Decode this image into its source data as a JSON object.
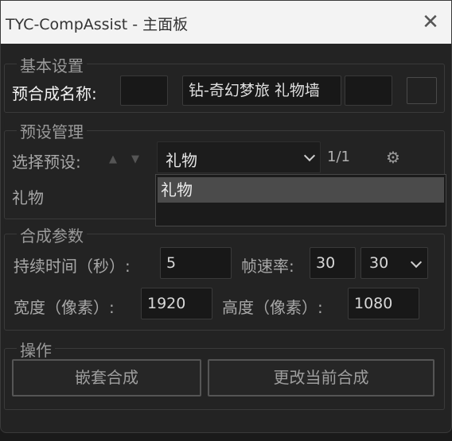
{
  "window": {
    "title": "TYC-CompAssist - 主面板",
    "close_glyph": "✕"
  },
  "basic": {
    "legend": "基本设置",
    "precomp_name_label": "预合成名称:",
    "field1_value": "",
    "field2_value": "钻-奇幻梦旅 礼物墙",
    "field3_value": ""
  },
  "presets": {
    "legend": "预设管理",
    "select_label": "选择预设:",
    "up_arrow": "▲",
    "down_arrow": "▼",
    "selected": "礼物",
    "counter": "1/1",
    "gear_glyph": "⚙",
    "name_label": "礼物",
    "dropdown_options": [
      "礼物"
    ]
  },
  "comp": {
    "legend": "合成参数",
    "duration_label": "持续时间（秒）:",
    "duration_value": "5",
    "fps_label": "帧速率:",
    "fps_value": "30",
    "fps_select": "30",
    "width_label": "宽度（像素）:",
    "width_value": "1920",
    "height_label": "高度（像素）:",
    "height_value": "1080"
  },
  "ops": {
    "legend": "操作",
    "nest_button": "嵌套合成",
    "change_button": "更改当前合成"
  }
}
